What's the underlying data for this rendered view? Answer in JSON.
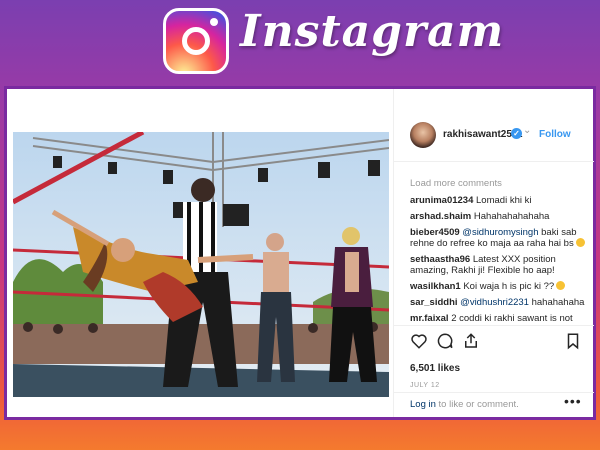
{
  "banner": {
    "brand": "Instagram"
  },
  "post": {
    "username": "rakhisawant2511",
    "follow_label": "Follow",
    "load_more": "Load more comments",
    "comments": [
      {
        "user": "arunima01234",
        "text": "Lomadi khi ki"
      },
      {
        "user": "arshad.shaim",
        "text": "Hahahahahahaha"
      },
      {
        "user": "bieber4509",
        "mention": "@sidhuromysingh",
        "text": "baki sab rehne do refree ko maja aa raha hai bs"
      },
      {
        "user": "sethaastha96",
        "text": "Latest XXX position amazing, Rakhi ji! Flexible ho aap!"
      },
      {
        "user": "wasilkhan1",
        "text": "Koi waja h is pic ki ??"
      },
      {
        "user": "sar_siddhi",
        "mention": "@vidhushri2231",
        "text": "hahahahaha"
      },
      {
        "user": "mr.faixal",
        "text": "2 coddi ki rakhi sawant is not"
      }
    ],
    "likes": "6,501 likes",
    "date": "JULY 12",
    "login_link": "Log in",
    "login_rest": " to like or comment.",
    "more_options": "•••"
  },
  "colors": {
    "accent": "#3897f0",
    "frame": "#7a2aa0"
  },
  "icons": [
    "instagram-logo",
    "verified-badge-icon",
    "heart-icon",
    "comment-icon",
    "share-icon",
    "bookmark-icon",
    "more-options-icon"
  ]
}
